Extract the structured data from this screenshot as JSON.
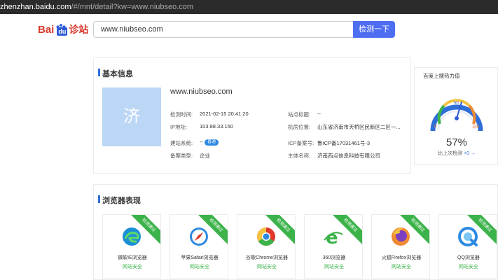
{
  "browser": {
    "url_host": "zhenzhan.baidu.com",
    "url_path": "/#/mnt/detail?kw=www.niubseo.com"
  },
  "logo": {
    "bai": "Bai",
    "du": "du",
    "jz": "诊站"
  },
  "search": {
    "value": "www.niubseo.com",
    "button": "检测一下"
  },
  "basic": {
    "title": "基本信息",
    "thumb_char": "济",
    "domain": "www.niubseo.com",
    "fields": {
      "check_time_label": "检测时间:",
      "check_time": "2021-02-15 20:41:20",
      "site_title_label": "站点标题:",
      "site_title": "--",
      "ip_label": "IP地址:",
      "ip": "103.88.33.150",
      "location_label": "机房位置:",
      "location": "山东省济南市天桥区民新区二区一...",
      "build_label": "建站系统:",
      "build": "--",
      "build_badge": "普通",
      "icp_label": "ICP备案号:",
      "icp": "鲁ICP备17031461号-3",
      "record_type_label": "备案类型:",
      "record_type": "企业",
      "owner_label": "主体名称:",
      "owner": "济南西点信息科技有限公司"
    }
  },
  "gauge": {
    "title": "百度上搜热力值",
    "value": 57,
    "value_text": "57%",
    "labels": {
      "min": "0",
      "mid": "50",
      "max": "100"
    },
    "sub": "比上次检测",
    "delta": "+0",
    "colors": {
      "blue": "#2e6fd8",
      "green": "#3cb34a",
      "yellow": "#f3c341",
      "orange": "#f08a33"
    }
  },
  "browsers": {
    "title": "浏览器表现",
    "ribbon": "检测通过",
    "items": [
      {
        "name": "微软IE浏览器",
        "status": "网站安全",
        "icon": "edge-icon"
      },
      {
        "name": "苹果Safari浏览器",
        "status": "网站安全",
        "icon": "safari-icon"
      },
      {
        "name": "谷歌Chrome浏览器",
        "status": "网站安全",
        "icon": "chrome-icon"
      },
      {
        "name": "360浏览器",
        "status": "网站安全",
        "icon": "360-browser-icon"
      },
      {
        "name": "火狐Firefox浏览器",
        "status": "网站安全",
        "icon": "firefox-icon"
      },
      {
        "name": "QQ浏览器",
        "status": "网站安全",
        "icon": "qq-browser-icon"
      }
    ]
  }
}
